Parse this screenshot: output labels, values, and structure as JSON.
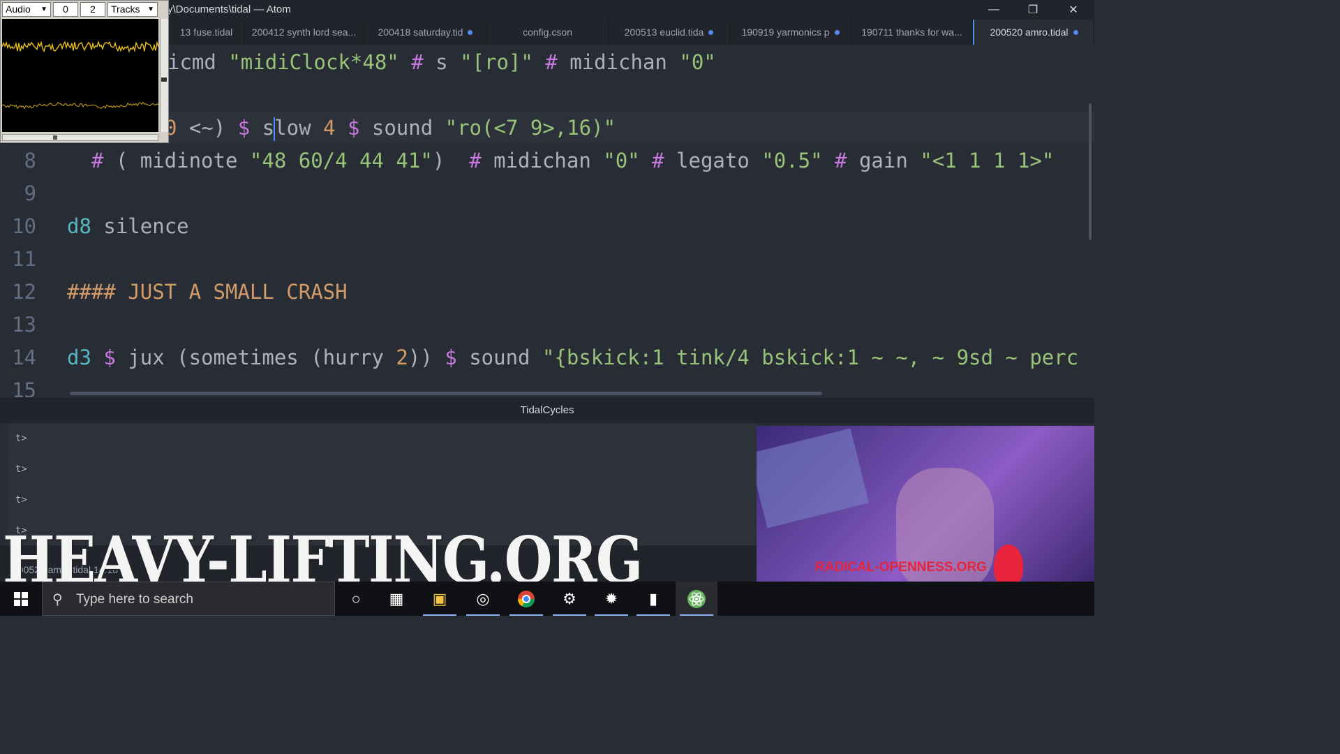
{
  "window": {
    "title": "y\\Documents\\tidal — Atom",
    "minimize_icon": "minimize-icon",
    "maximize_icon": "restore-icon",
    "close_icon": "close-icon"
  },
  "tabs": [
    {
      "label": "13 fuse.tidal",
      "modified": false
    },
    {
      "label": "200412 synth lord sea...",
      "modified": false
    },
    {
      "label": "200418 saturday.tid",
      "modified": true
    },
    {
      "label": "config.cson",
      "modified": false
    },
    {
      "label": "200513 euclid.tida",
      "modified": true
    },
    {
      "label": "190919 yarmonics p",
      "modified": true
    },
    {
      "label": "190711 thanks for wa...",
      "modified": false
    },
    {
      "label": "200520 amro.tidal",
      "modified": true,
      "active": true
    }
  ],
  "editor": {
    "lines": [
      {
        "num": "",
        "segments": [
          [
            "fn",
            "icmd "
          ],
          [
            "str",
            "\"midiClock*48\""
          ],
          [
            "op",
            " # "
          ],
          [
            "fn",
            "s "
          ],
          [
            "str",
            "\"[ro]\""
          ],
          [
            "op",
            " # "
          ],
          [
            "fn",
            "midichan "
          ],
          [
            "str",
            "\"0\""
          ]
        ]
      },
      {
        "num": "",
        "segments": []
      },
      {
        "num": "",
        "segments": [
          [
            "num",
            "0"
          ],
          [
            "fn",
            " <~) "
          ],
          [
            "op",
            "$ "
          ],
          [
            "fn",
            "s"
          ],
          [
            "caret",
            ""
          ],
          [
            "fn",
            "low "
          ],
          [
            "num",
            "4 "
          ],
          [
            "op",
            "$ "
          ],
          [
            "fn",
            "sound "
          ],
          [
            "str",
            "\"ro(<7 9>,16)\""
          ]
        ]
      },
      {
        "num": "8",
        "segments": [
          [
            "fn",
            "  "
          ],
          [
            "op",
            "# "
          ],
          [
            "fn",
            "( midinote "
          ],
          [
            "str",
            "\"48 60/4 44 41\""
          ],
          [
            "fn",
            ")  "
          ],
          [
            "op",
            "# "
          ],
          [
            "fn",
            "midichan "
          ],
          [
            "str",
            "\"0\""
          ],
          [
            "op",
            " # "
          ],
          [
            "fn",
            "legato "
          ],
          [
            "str",
            "\"0.5\""
          ],
          [
            "op",
            " # "
          ],
          [
            "fn",
            "gain "
          ],
          [
            "str",
            "\"<1 1 1 1>\""
          ]
        ]
      },
      {
        "num": "9",
        "segments": []
      },
      {
        "num": "10",
        "segments": [
          [
            "kw",
            "d8 "
          ],
          [
            "fn",
            "silence"
          ]
        ]
      },
      {
        "num": "11",
        "segments": []
      },
      {
        "num": "12",
        "segments": [
          [
            "cm",
            "#### JUST A SMALL CRASH"
          ]
        ]
      },
      {
        "num": "13",
        "segments": []
      },
      {
        "num": "14",
        "segments": [
          [
            "kw",
            "d3 "
          ],
          [
            "op",
            "$ "
          ],
          [
            "fn",
            "jux (sometimes (hurry "
          ],
          [
            "num",
            "2"
          ],
          [
            "fn",
            ")) "
          ],
          [
            "op",
            "$ "
          ],
          [
            "fn",
            "sound "
          ],
          [
            "str",
            "\"{bskick:1 tink/4 bskick:1 ~ ~, ~ 9sd ~ perc"
          ]
        ]
      },
      {
        "num": "15",
        "segments": []
      }
    ]
  },
  "panel": {
    "title": "TidalCycles",
    "prompts": [
      "t>",
      "t>",
      "t>",
      "t>"
    ]
  },
  "statusbar": {
    "text": "200520 amro.tidal 14:18"
  },
  "audio_widget": {
    "source": "Audio",
    "field_a": "0",
    "field_b": "2",
    "mode": "Tracks",
    "waveform_color": "#e8c020"
  },
  "overlay": {
    "text": "HEAVY-LIFTING.ORG"
  },
  "webcam": {
    "caption": "RADICAL-OPENNESS.ORG"
  },
  "taskbar": {
    "search_placeholder": "Type here to search",
    "icons": [
      "windows-start-icon",
      "cortana-icon",
      "task-view-icon",
      "file-explorer-icon",
      "obs-icon",
      "chrome-icon",
      "settings-icon",
      "tidal-spiral-icon",
      "package-icon",
      "atom-icon"
    ]
  }
}
